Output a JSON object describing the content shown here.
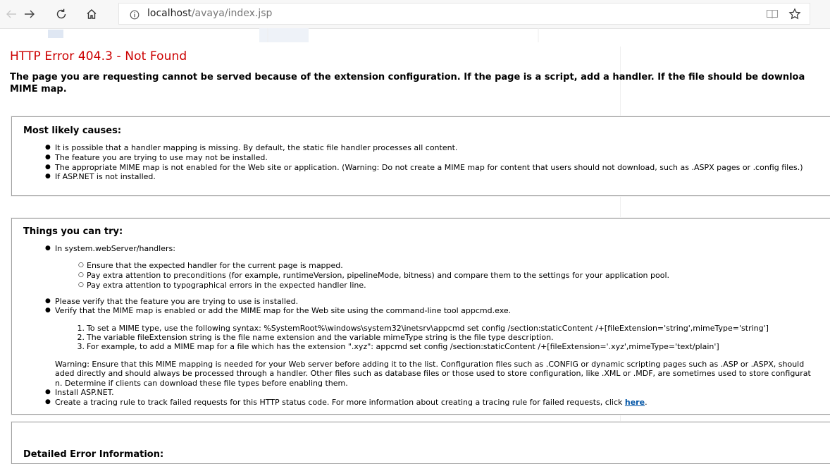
{
  "browser": {
    "url_host": "localhost",
    "url_path": "/avaya/index.jsp"
  },
  "error": {
    "title": "HTTP Error 404.3 - Not Found",
    "description_line1": "The page you are requesting cannot be served because of the extension configuration. If the page is a script, add a handler. If the file should be downloa",
    "description_line2": "MIME map."
  },
  "causes": {
    "heading": "Most likely causes:",
    "items": [
      "It is possible that a handler mapping is missing. By default, the static file handler processes all content.",
      "The feature you are trying to use may not be installed.",
      "The appropriate MIME map is not enabled for the Web site or application. (Warning: Do not create a MIME map for content that users should not download, such as .ASPX pages or .config files.)",
      "If ASP.NET is not installed."
    ]
  },
  "try": {
    "heading": "Things you can try:",
    "handlers_intro": "In system.webServer/handlers:",
    "handler_items": [
      "Ensure that the expected handler for the current page is mapped.",
      "Pay extra attention to preconditions (for example, runtimeVersion, pipelineMode, bitness) and compare them to the settings for your application pool.",
      "Pay extra attention to typographical errors in the expected handler line."
    ],
    "verify_feature": "Please verify that the feature you are trying to use is installed.",
    "verify_mime": "Verify that the MIME map is enabled or add the MIME map for the Web site using the command-line tool appcmd.exe.",
    "steps": [
      "To set a MIME type, use the following syntax: %SystemRoot%\\windows\\system32\\inetsrv\\appcmd set config /section:staticContent /+[fileExtension='string',mimeType='string']",
      "The variable fileExtension string is the file name extension and the variable mimeType string is the file type description.",
      "For example, to add a MIME map for a file which has the extension \".xyz\": appcmd set config /section:staticContent /+[fileExtension='.xyz',mimeType='text/plain']"
    ],
    "step_numbers": [
      "1.",
      "2.",
      "3."
    ],
    "warning_line1": "Warning: Ensure that this MIME mapping is needed for your Web server before adding it to the list. Configuration files such as .CONFIG or dynamic scripting pages such as .ASP or .ASPX, should",
    "warning_line2": "aded directly and should always be processed through a handler. Other files such as database files or those used to store configuration, like .XML or .MDF, are sometimes used to store configurat",
    "warning_line3": "n. Determine if clients can download these file types before enabling them.",
    "install_aspnet": "Install ASP.NET.",
    "tracing_text": "Create a tracing rule to track failed requests for this HTTP status code. For more information about creating a tracing rule for failed requests, click ",
    "tracing_link": "here",
    "tracing_end": "."
  },
  "detailed": {
    "heading": "Detailed Error Information:"
  }
}
